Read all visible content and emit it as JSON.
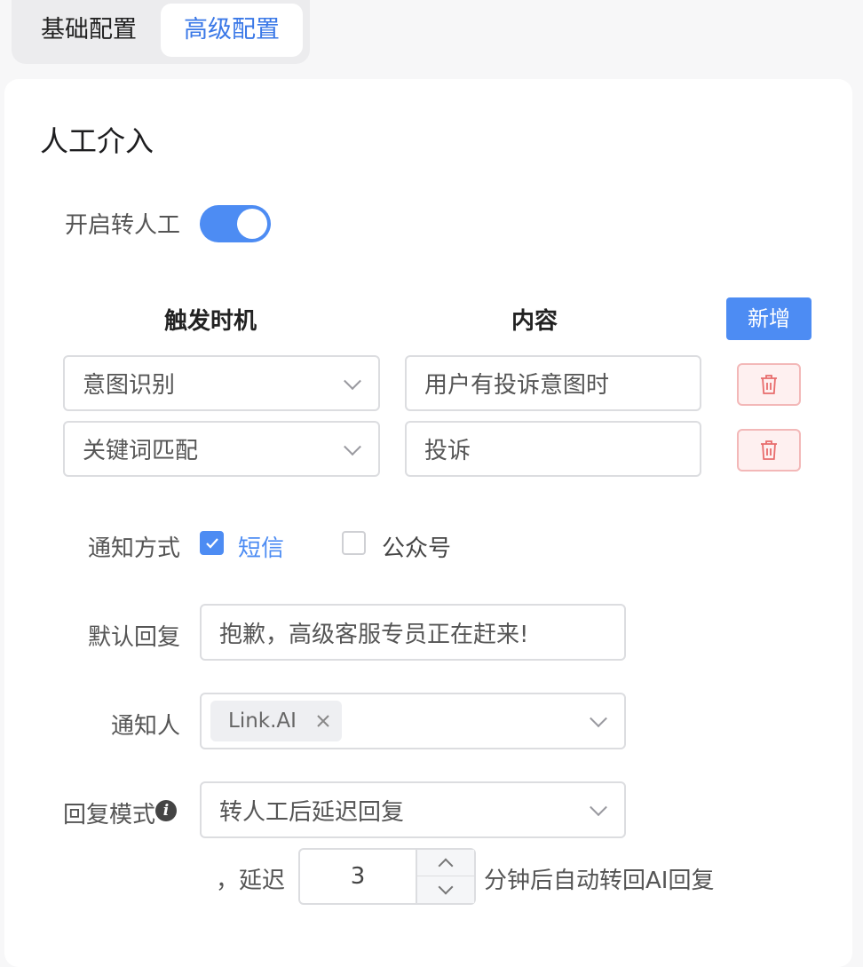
{
  "tabs": [
    {
      "label": "基础配置",
      "active": false
    },
    {
      "label": "高级配置",
      "active": true
    }
  ],
  "section_title": "人工介入",
  "transfer": {
    "label": "开启转人工",
    "enabled": true
  },
  "triggers": {
    "col_timing": "触发时机",
    "col_content": "内容",
    "add_label": "新增",
    "rows": [
      {
        "timing": "意图识别",
        "content": "用户有投诉意图时"
      },
      {
        "timing": "关键词匹配",
        "content": "投诉"
      }
    ]
  },
  "notify_method": {
    "label": "通知方式",
    "options": [
      {
        "label": "短信",
        "checked": true
      },
      {
        "label": "公众号",
        "checked": false
      }
    ]
  },
  "default_reply": {
    "label": "默认回复",
    "value": "抱歉，高级客服专员正在赶来!"
  },
  "notify_person": {
    "label": "通知人",
    "tags": [
      "Link.AI"
    ]
  },
  "reply_mode": {
    "label": "回复模式",
    "info_icon": "info-icon",
    "value": "转人工后延迟回复",
    "delay_prefix": "，延迟",
    "delay_value": "3",
    "delay_suffix": "分钟后自动转回AI回复"
  },
  "colors": {
    "primary": "#4d8cf3",
    "danger": "#e86c6c",
    "danger_bg": "#fef0f0"
  }
}
